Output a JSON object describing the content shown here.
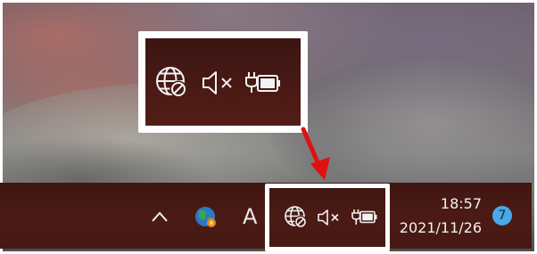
{
  "colors": {
    "taskbar": "#4b1a14",
    "highlight_border": "#ffffff",
    "arrow": "#e01010",
    "notification_badge": "#4aa7e8",
    "icon": "#f2f2f2"
  },
  "zoom_callout": {
    "icons": [
      "globe-no-internet-icon",
      "speaker-muted-icon",
      "battery-charging-icon"
    ]
  },
  "taskbar": {
    "tray": {
      "show_hidden_icons": "chevron-up-icon",
      "app_icon": "colorful-globe-app-icon",
      "ime_label": "A",
      "status_icons": [
        "globe-no-internet-icon",
        "speaker-muted-icon",
        "battery-charging-icon"
      ]
    },
    "clock": {
      "time": "18:57",
      "date": "2021/11/26"
    },
    "notifications": {
      "count": "7"
    }
  }
}
